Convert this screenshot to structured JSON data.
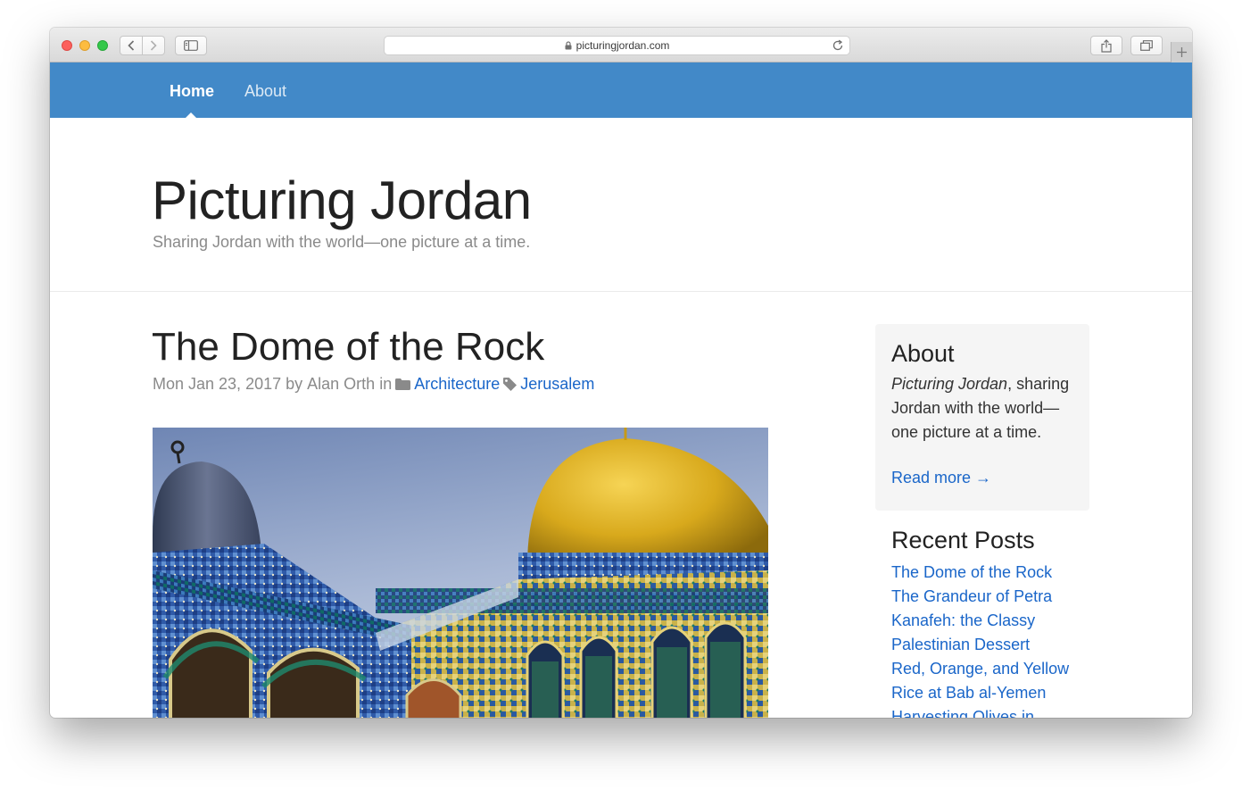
{
  "browser": {
    "url": "picturingjordan.com"
  },
  "nav": {
    "items": [
      {
        "label": "Home",
        "active": true
      },
      {
        "label": "About",
        "active": false
      }
    ]
  },
  "header": {
    "title": "Picturing Jordan",
    "tagline": "Sharing Jordan with the world—one picture at a time."
  },
  "post": {
    "title": "The Dome of the Rock",
    "meta_date": "Mon Jan 23, 2017",
    "meta_by": "by",
    "meta_author": "Alan Orth",
    "meta_in": "in",
    "category": "Architecture",
    "tag": "Jerusalem"
  },
  "sidebar": {
    "about": {
      "heading": "About",
      "site_name": "Picturing Jordan",
      "text_rest": ", sharing Jordan with the world—one picture at a time.",
      "read_more": "Read more →"
    },
    "recent": {
      "heading": "Recent Posts",
      "posts": [
        "The Dome of the Rock",
        "The Grandeur of Petra",
        "Kanafeh: the Classy Palestinian Dessert",
        "Red, Orange, and Yellow Rice at Bab al-Yemen",
        "Harvesting Olives in"
      ]
    }
  },
  "colors": {
    "navbar": "#4289c8",
    "link": "#1a66c9",
    "muted": "#8a8a8a"
  }
}
